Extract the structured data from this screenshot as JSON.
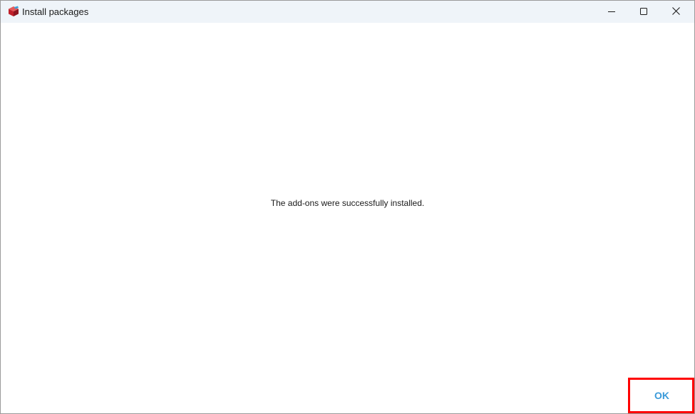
{
  "window": {
    "title": "Install packages",
    "app_icon": "cube-package-icon",
    "controls": {
      "minimize_icon": "minimize-icon",
      "maximize_icon": "maximize-icon",
      "close_icon": "close-icon"
    }
  },
  "dialog": {
    "message": "The add-ons were successfully installed.",
    "ok_label": "OK"
  },
  "colors": {
    "titlebar_bg": "#eff4f9",
    "ok_text": "#3a9ad9",
    "highlight": "#ff0000"
  }
}
